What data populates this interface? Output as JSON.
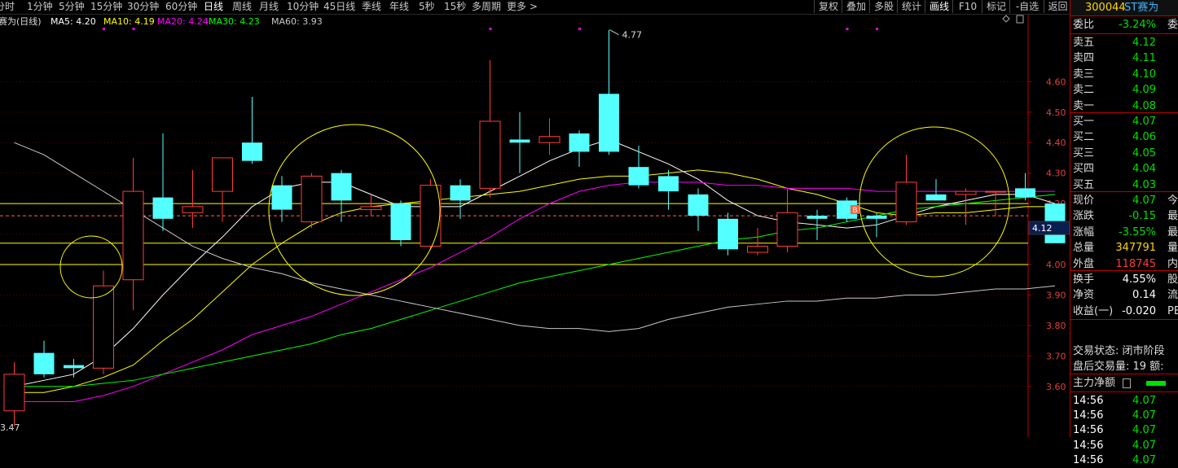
{
  "toolbar": {
    "periods": [
      "分时",
      "1分钟",
      "5分钟",
      "15分钟",
      "30分钟",
      "60分钟",
      "日线",
      "周线",
      "月线",
      "10分钟",
      "45日线",
      "季线",
      "年线",
      "5秒",
      "15秒",
      "多周期",
      "更多 >"
    ],
    "active_period": "日线",
    "tools": [
      "复权",
      "叠加",
      "多股",
      "统计",
      "画线",
      "F10",
      "标记",
      "-自选",
      "返回"
    ],
    "highlight_tool": "画线"
  },
  "ma_bar": {
    "title": "赛为(日线)",
    "items": [
      {
        "label": "MA5: 4.20",
        "color": "#ffffff"
      },
      {
        "label": "MA10: 4.19",
        "color": "#ffff00"
      },
      {
        "label": "MA20: 4.24",
        "color": "#ff00ff"
      },
      {
        "label": "MA30: 4.23",
        "color": "#00ff00"
      },
      {
        "label": "MA60: 3.93",
        "color": "#c8c8c8"
      }
    ]
  },
  "colors": {
    "up": "#ff3c3c",
    "down": "#54ffff",
    "ma5": "#ffffff",
    "ma10": "#ffff00",
    "ma20": "#ff00ff",
    "ma30": "#00ff00",
    "ma60": "#c8c8c8",
    "marker": "#ff00ff"
  },
  "chart_data": {
    "type": "candlestick",
    "y_min": 3.47,
    "y_max": 4.77,
    "y_ticks": [
      "4.60",
      "4.50",
      "4.40",
      "4.30",
      "4.20",
      "4.10",
      "4.00",
      "3.90",
      "3.80",
      "3.70",
      "3.60"
    ],
    "current_price_label": "4.12",
    "high_label": "4.77",
    "low_label": "3.47",
    "candles": [
      {
        "o": 3.52,
        "h": 3.68,
        "l": 3.47,
        "c": 3.64
      },
      {
        "o": 3.71,
        "h": 3.75,
        "l": 3.63,
        "c": 3.64
      },
      {
        "o": 3.67,
        "h": 3.69,
        "l": 3.63,
        "c": 3.66
      },
      {
        "o": 3.66,
        "h": 3.98,
        "l": 3.64,
        "c": 3.93
      },
      {
        "o": 3.95,
        "h": 4.35,
        "l": 3.85,
        "c": 4.24
      },
      {
        "o": 4.22,
        "h": 4.43,
        "l": 4.11,
        "c": 4.15
      },
      {
        "o": 4.17,
        "h": 4.31,
        "l": 4.12,
        "c": 4.19
      },
      {
        "o": 4.24,
        "h": 4.34,
        "l": 4.14,
        "c": 4.35
      },
      {
        "o": 4.4,
        "h": 4.55,
        "l": 4.33,
        "c": 4.34
      },
      {
        "o": 4.26,
        "h": 4.29,
        "l": 4.14,
        "c": 4.18
      },
      {
        "o": 4.14,
        "h": 4.3,
        "l": 4.12,
        "c": 4.29
      },
      {
        "o": 4.3,
        "h": 4.31,
        "l": 4.14,
        "c": 4.21
      },
      {
        "o": 4.18,
        "h": 4.23,
        "l": 4.16,
        "c": 4.19
      },
      {
        "o": 4.2,
        "h": 4.21,
        "l": 4.06,
        "c": 4.08
      },
      {
        "o": 4.06,
        "h": 4.28,
        "l": 4.05,
        "c": 4.26
      },
      {
        "o": 4.26,
        "h": 4.28,
        "l": 4.15,
        "c": 4.21
      },
      {
        "o": 4.25,
        "h": 4.67,
        "l": 4.22,
        "c": 4.47
      },
      {
        "o": 4.41,
        "h": 4.5,
        "l": 4.3,
        "c": 4.4
      },
      {
        "o": 4.4,
        "h": 4.48,
        "l": 4.36,
        "c": 4.42
      },
      {
        "o": 4.43,
        "h": 4.44,
        "l": 4.32,
        "c": 4.37
      },
      {
        "o": 4.56,
        "h": 4.77,
        "l": 4.36,
        "c": 4.37
      },
      {
        "o": 4.32,
        "h": 4.39,
        "l": 4.25,
        "c": 4.26
      },
      {
        "o": 4.29,
        "h": 4.31,
        "l": 4.18,
        "c": 4.24
      },
      {
        "o": 4.23,
        "h": 4.25,
        "l": 4.11,
        "c": 4.16
      },
      {
        "o": 4.15,
        "h": 4.17,
        "l": 4.03,
        "c": 4.05
      },
      {
        "o": 4.04,
        "h": 4.12,
        "l": 4.03,
        "c": 4.06
      },
      {
        "o": 4.06,
        "h": 4.25,
        "l": 4.04,
        "c": 4.17
      },
      {
        "o": 4.16,
        "h": 4.18,
        "l": 4.08,
        "c": 4.15
      },
      {
        "o": 4.21,
        "h": 4.22,
        "l": 4.14,
        "c": 4.15
      },
      {
        "o": 4.16,
        "h": 4.17,
        "l": 4.09,
        "c": 4.15
      },
      {
        "o": 4.14,
        "h": 4.36,
        "l": 4.13,
        "c": 4.27
      },
      {
        "o": 4.23,
        "h": 4.28,
        "l": 4.21,
        "c": 4.21
      },
      {
        "o": 4.23,
        "h": 4.25,
        "l": 4.13,
        "c": 4.24
      },
      {
        "o": 4.24,
        "h": 4.24,
        "l": 4.16,
        "c": 4.24
      },
      {
        "o": 4.25,
        "h": 4.3,
        "l": 4.21,
        "c": 4.22
      },
      {
        "o": 4.2,
        "h": 4.2,
        "l": 4.07,
        "c": 4.07
      }
    ],
    "ma_lines": {
      "ma5": [
        3.6,
        3.62,
        3.64,
        3.7,
        3.79,
        3.9,
        4.0,
        4.09,
        4.19,
        4.25,
        4.27,
        4.27,
        4.23,
        4.19,
        4.19,
        4.19,
        4.24,
        4.29,
        4.34,
        4.38,
        4.41,
        4.37,
        4.33,
        4.28,
        4.21,
        4.16,
        4.14,
        4.13,
        4.12,
        4.13,
        4.16,
        4.19,
        4.21,
        4.23,
        4.23,
        4.2
      ],
      "ma10": [
        3.58,
        3.58,
        3.6,
        3.63,
        3.67,
        3.75,
        3.82,
        3.91,
        4.0,
        4.07,
        4.13,
        4.17,
        4.19,
        4.2,
        4.21,
        4.22,
        4.23,
        4.24,
        4.26,
        4.28,
        4.29,
        4.29,
        4.3,
        4.31,
        4.3,
        4.28,
        4.25,
        4.23,
        4.2,
        4.17,
        4.16,
        4.17,
        4.17,
        4.18,
        4.19,
        4.19
      ],
      "ma20": [
        3.55,
        3.55,
        3.55,
        3.57,
        3.6,
        3.64,
        3.68,
        3.72,
        3.77,
        3.8,
        3.83,
        3.87,
        3.91,
        3.95,
        3.99,
        4.04,
        4.09,
        4.15,
        4.2,
        4.24,
        4.26,
        4.27,
        4.27,
        4.27,
        4.26,
        4.26,
        4.25,
        4.25,
        4.25,
        4.24,
        4.24,
        4.24,
        4.24,
        4.24,
        4.24,
        4.24
      ],
      "ma30": [
        3.6,
        3.6,
        3.6,
        3.61,
        3.62,
        3.64,
        3.66,
        3.68,
        3.7,
        3.72,
        3.74,
        3.77,
        3.79,
        3.82,
        3.85,
        3.88,
        3.91,
        3.94,
        3.96,
        3.98,
        4.0,
        4.02,
        4.04,
        4.06,
        4.08,
        4.09,
        4.11,
        4.12,
        4.14,
        4.16,
        4.18,
        4.19,
        4.2,
        4.21,
        4.22,
        4.23
      ],
      "ma60": [
        4.4,
        4.36,
        4.3,
        4.24,
        4.18,
        4.12,
        4.06,
        4.02,
        3.99,
        3.97,
        3.94,
        3.92,
        3.9,
        3.88,
        3.86,
        3.84,
        3.82,
        3.8,
        3.79,
        3.79,
        3.78,
        3.79,
        3.82,
        3.84,
        3.86,
        3.87,
        3.88,
        3.88,
        3.89,
        3.89,
        3.9,
        3.9,
        3.91,
        3.92,
        3.92,
        3.93
      ]
    },
    "hlines": [
      4.2,
      4.16,
      4.07,
      4.0
    ],
    "markers_top": [
      3,
      4,
      16,
      19,
      28,
      29
    ]
  },
  "sidebar": {
    "code": "300044",
    "name": "ST赛为",
    "weibi": {
      "label": "委比",
      "value": "-3.24%",
      "tail": "委"
    },
    "sells": [
      {
        "label": "卖五",
        "value": "4.12"
      },
      {
        "label": "卖四",
        "value": "4.11"
      },
      {
        "label": "卖三",
        "value": "4.10"
      },
      {
        "label": "卖二",
        "value": "4.09"
      },
      {
        "label": "卖一",
        "value": "4.08"
      }
    ],
    "buys": [
      {
        "label": "买一",
        "value": "4.07"
      },
      {
        "label": "买二",
        "value": "4.06"
      },
      {
        "label": "买三",
        "value": "4.05"
      },
      {
        "label": "买四",
        "value": "4.04"
      },
      {
        "label": "买五",
        "value": "4.03"
      }
    ],
    "stats": [
      {
        "label": "现价",
        "value": "4.07",
        "tail": "今",
        "cls": "green"
      },
      {
        "label": "涨跌",
        "value": "-0.15",
        "tail": "最",
        "cls": "green"
      },
      {
        "label": "涨幅",
        "value": "-3.55%",
        "tail": "最",
        "cls": "green"
      },
      {
        "label": "总量",
        "value": "347791",
        "tail": "量",
        "cls": "yellow"
      },
      {
        "label": "外盘",
        "value": "118745",
        "tail": "内",
        "cls": "red"
      }
    ],
    "stats2": [
      {
        "label": "换手",
        "value": "4.55%",
        "tail": "股"
      },
      {
        "label": "净资",
        "value": "0.14",
        "tail": "流"
      },
      {
        "label": "收益(一)",
        "value": "-0.020",
        "tail": "PE"
      }
    ],
    "trade_status": "交易状态: 闭市阶段",
    "after_hours": "盘后交易量: 19  额:",
    "net_label": "主力净额",
    "ticks": [
      {
        "time": "14:56",
        "price": "4.07"
      },
      {
        "time": "14:56",
        "price": "4.07"
      },
      {
        "time": "14:56",
        "price": "4.07"
      },
      {
        "time": "14:56",
        "price": "4.07"
      },
      {
        "time": "14:56",
        "price": "4.07"
      }
    ]
  }
}
